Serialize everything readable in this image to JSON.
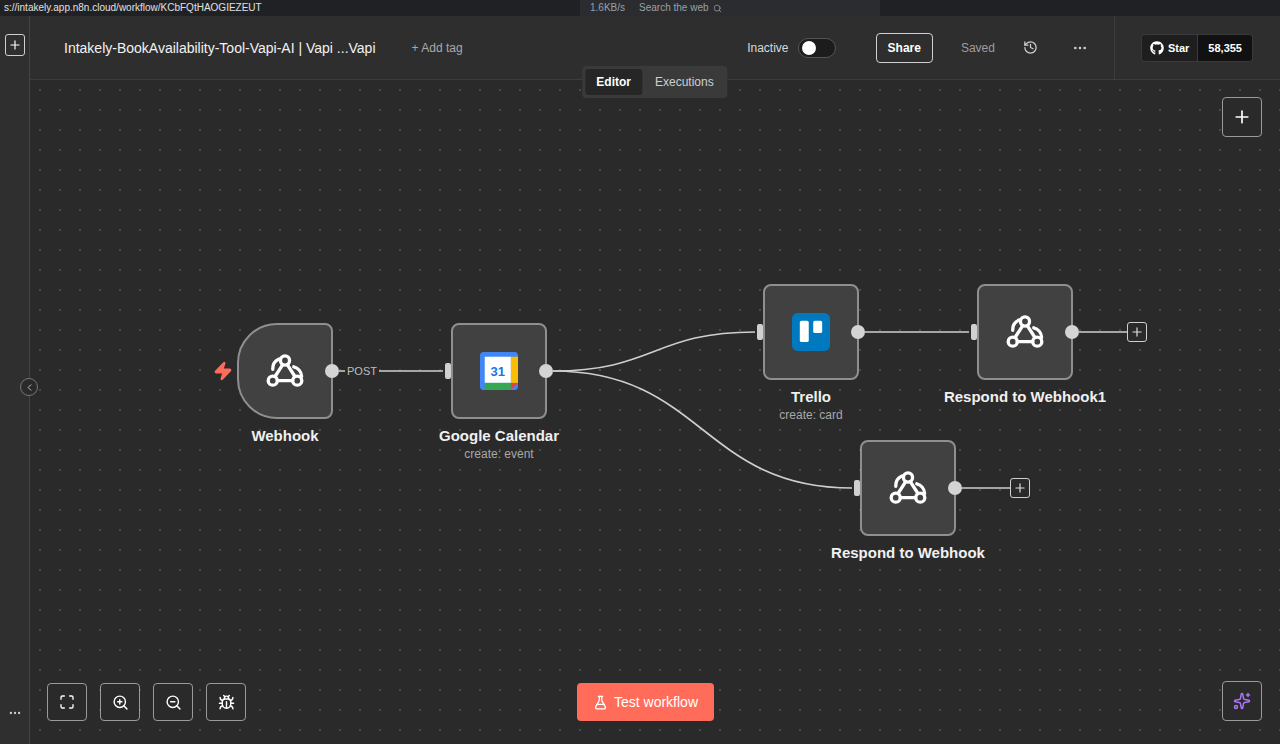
{
  "browser": {
    "url": "s://intakely.app.n8n.cloud/workflow/KCbFQtHAOGIEZEUT",
    "speed": "1.6KB/s",
    "search_placeholder": "Search the web"
  },
  "header": {
    "title": "Intakely-BookAvailability-Tool-Vapi-AI | Vapi ...Vapi",
    "add_tag": "+ Add tag",
    "active_label": "Inactive",
    "active": false,
    "share": "Share",
    "save_status": "Saved",
    "github": {
      "label": "Star",
      "count": "58,355"
    }
  },
  "tabs": [
    {
      "label": "Editor",
      "selected": true
    },
    {
      "label": "Executions",
      "selected": false
    }
  ],
  "nodes": [
    {
      "name": "Webhook",
      "subtitle": "",
      "kind": "trigger",
      "badge": ""
    },
    {
      "name": "Google Calendar",
      "subtitle": "create: event",
      "kind": "calendar",
      "badge": "31"
    },
    {
      "name": "Trello",
      "subtitle": "create: card",
      "kind": "trello",
      "badge": ""
    },
    {
      "name": "Respond to Webhook1",
      "subtitle": "",
      "kind": "respond",
      "badge": ""
    },
    {
      "name": "Respond to Webhook",
      "subtitle": "",
      "kind": "respond",
      "badge": ""
    }
  ],
  "edges": [
    {
      "from": "Webhook",
      "to": "Google Calendar",
      "label": "POST"
    },
    {
      "from": "Google Calendar",
      "to": "Trello",
      "label": ""
    },
    {
      "from": "Google Calendar",
      "to": "Respond to Webhook",
      "label": ""
    },
    {
      "from": "Trello",
      "to": "Respond to Webhook1",
      "label": ""
    }
  ],
  "test_button": "Test workflow"
}
